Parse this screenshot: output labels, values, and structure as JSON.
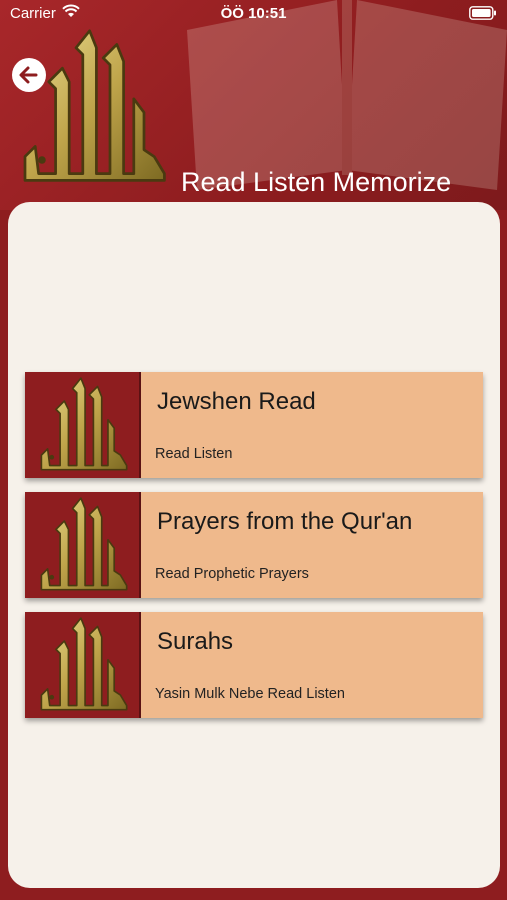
{
  "status_bar": {
    "carrier": "Carrier",
    "time": "ÖÖ 10:51"
  },
  "header": {
    "title": "Read Listen Memorize",
    "back_icon": "arrow-left-icon",
    "logo_icon": "allah-calligraphy-icon"
  },
  "menu": {
    "items": [
      {
        "title": "Jewshen Read",
        "subtitle": "Read Listen"
      },
      {
        "title": "Prayers from the Qur'an",
        "subtitle": "Read Prophetic Prayers"
      },
      {
        "title": "Surahs",
        "subtitle": "Yasin Mulk Nebe Read Listen"
      }
    ]
  },
  "colors": {
    "primary_red": "#8e1d1f",
    "card_background": "#f6f1ea",
    "menu_item_background": "#efb98c",
    "logo_gold": "#c9b35a"
  }
}
